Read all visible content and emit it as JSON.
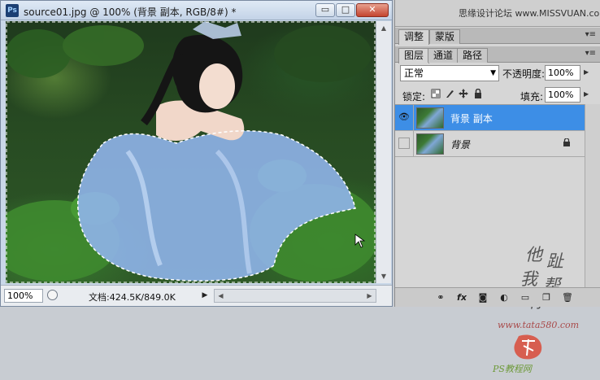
{
  "document": {
    "title": "source01.jpg @ 100% (背景 副本, RGB/8#) *",
    "app_icon": "Ps",
    "window_buttons": {
      "minimize": "▭",
      "maximize": "□",
      "close": "✕"
    },
    "zoom": "100%",
    "doc_info": "文档:424.5K/849.0K"
  },
  "site_credit": "思缘设计论坛 www.MISSVUAN.com",
  "panels": {
    "upper_tabs": [
      "调整",
      "蒙版"
    ],
    "layer_tabs": [
      "图层",
      "通道",
      "路径"
    ]
  },
  "layers_panel": {
    "blend_mode": "正常",
    "opacity_label": "不透明度:",
    "opacity_value": "100%",
    "lock_label": "锁定:",
    "fill_label": "填充:",
    "fill_value": "100%",
    "layers": [
      {
        "name": "背景 副本",
        "visible": true,
        "selected": true
      },
      {
        "name": "背景",
        "visible": false,
        "selected": false,
        "locked": true
      }
    ]
  },
  "watermark": {
    "chars": [
      "他",
      "趾",
      "我",
      "帮",
      "你"
    ],
    "site": "www.tata580.com",
    "tag": "PS教程网"
  },
  "colors": {
    "selected_layer": "#3d8ee6",
    "panel_bg": "#d6d6d6",
    "close_button": "#c4452f"
  }
}
